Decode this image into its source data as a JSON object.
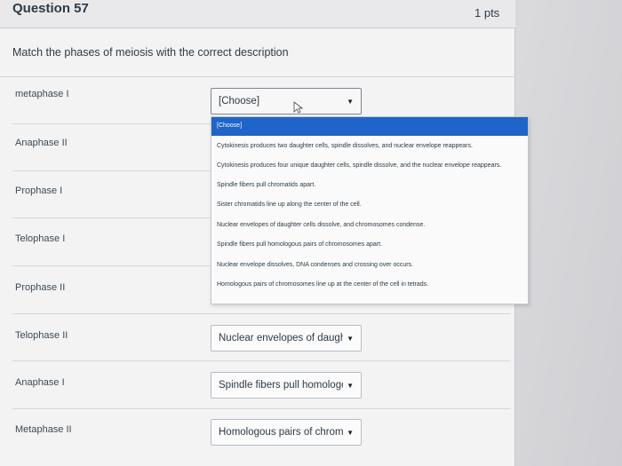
{
  "question": {
    "title": "Question 57",
    "points": "1 pts",
    "prompt": "Match the phases of meiosis with the correct description"
  },
  "rows": [
    {
      "label": "metaphase I",
      "selected": "[Choose]"
    },
    {
      "label": "Anaphase II",
      "selected": ""
    },
    {
      "label": "Prophase I",
      "selected": ""
    },
    {
      "label": "Telophase I",
      "selected": ""
    },
    {
      "label": "Prophase II",
      "selected": ""
    },
    {
      "label": "Telophase II",
      "selected": "Nuclear envelopes of daughte"
    },
    {
      "label": "Anaphase I",
      "selected": "Spindle fibers pull homologou"
    },
    {
      "label": "Metaphase II",
      "selected": "Homologous pairs of chromo:"
    }
  ],
  "dropdown": {
    "options": [
      "[Choose]",
      "Cytokinesis produces two daughter cells, spindle dissolves, and nuclear envelope reappears.",
      "Cytokinesis produces four unique daughter cells, spindle dissolve, and the nuclear envelope reappears.",
      "Spindle fibers pull chromatids apart.",
      "Sister chromatids line up along the center of the cell.",
      "Nuclear envelopes of daughter cells dissolve, and chromosomes condense.",
      "Spindle fibers pull homologous pairs of chromosomes apart.",
      "Nuclear envelope dissolves, DNA condenses and crossing over occurs.",
      "Homologous pairs of chromosomes line up at the center of the cell in tetrads."
    ]
  },
  "colors": {
    "highlight": "#1f64c9",
    "text": "#2d3b45"
  },
  "icons": {
    "dropdown_arrow": "triangle-down-icon",
    "cursor": "mouse-pointer-icon"
  }
}
